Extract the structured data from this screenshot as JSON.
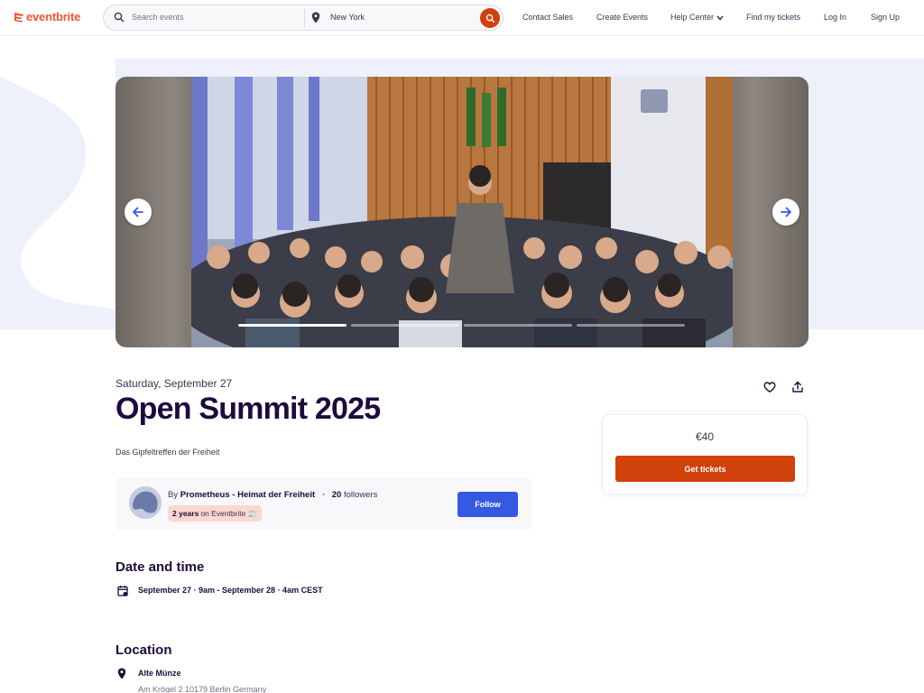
{
  "header": {
    "logo_text": "eventbrite",
    "search_placeholder": "Search events",
    "location_value": "New York",
    "nav": [
      "Contact Sales",
      "Create Events",
      "Help Center",
      "Find my tickets",
      "Log In",
      "Sign Up"
    ]
  },
  "carousel": {
    "slide_count": 4,
    "active_slide": 1,
    "icons": {
      "prev": "arrow-left-icon",
      "next": "arrow-right-icon"
    }
  },
  "event": {
    "date": "Saturday, September 27",
    "title": "Open Summit 2025",
    "summary": "Das Gipfeltreffen der Freiheit",
    "actions": {
      "like": "heart-icon",
      "share": "share-icon"
    }
  },
  "organizer": {
    "by_prefix": "By",
    "name": "Prometheus - Heimat der Freiheit",
    "followers_count": "20",
    "followers_label": "followers",
    "badge_bold": "2 years",
    "badge_rest": "on Eventbrite",
    "badge_emoji": "📰",
    "follow_label": "Follow"
  },
  "tickets": {
    "price": "€40",
    "button_label": "Get tickets"
  },
  "date_time": {
    "heading": "Date and time",
    "value": "September 27 · 9am - September 28 · 4am CEST"
  },
  "location": {
    "heading": "Location",
    "venue": "Alte Münze",
    "address": "Am Krögel 2 10179 Berlin Germany"
  },
  "colors": {
    "brand": "#f05537",
    "cta": "#d1410c",
    "follow": "#3659e3",
    "ink": "#1e0a3c"
  }
}
